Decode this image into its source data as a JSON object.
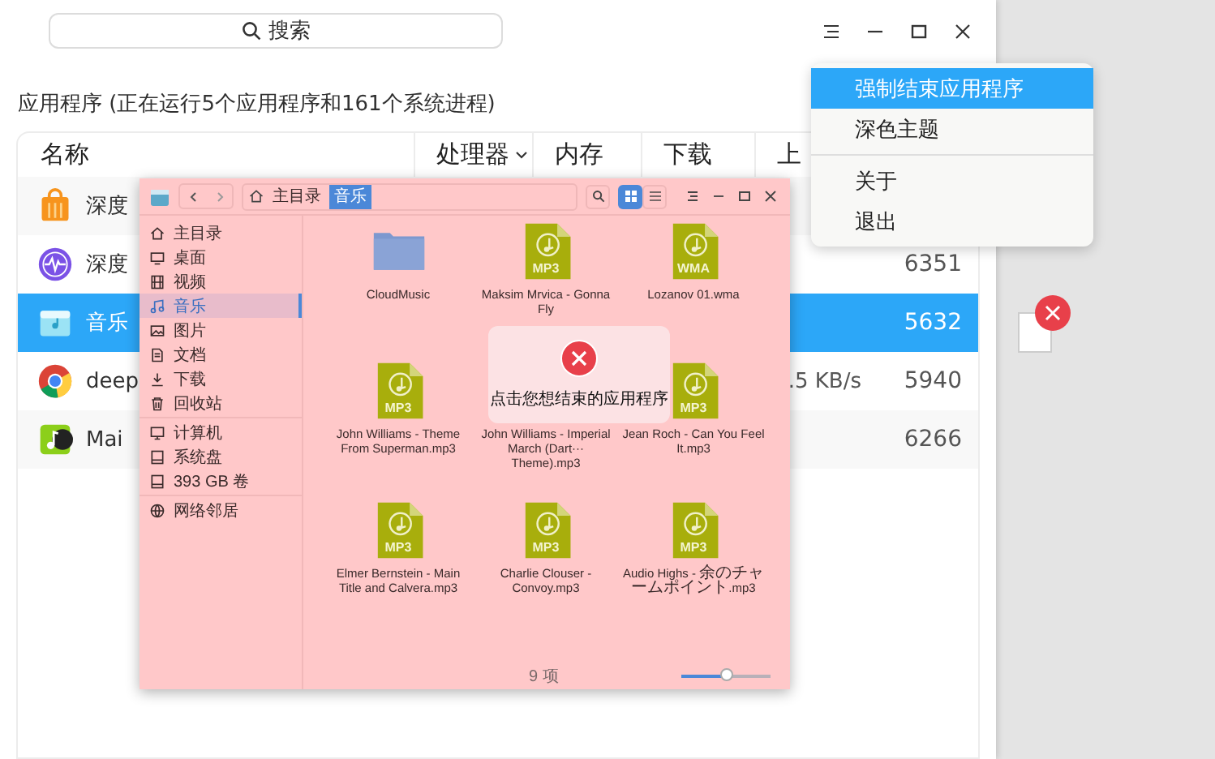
{
  "search": {
    "placeholder": "搜索"
  },
  "caption": "应用程序 (正在运行5个应用程序和161个系统进程)",
  "table": {
    "columns": [
      {
        "label": "名称",
        "sorted": false
      },
      {
        "label": "处理器",
        "sorted": true
      },
      {
        "label": "内存",
        "sorted": false
      },
      {
        "label": "下载",
        "sorted": false
      },
      {
        "label": "上",
        "sorted": false
      }
    ],
    "rows": [
      {
        "name": "深度",
        "selected": false
      },
      {
        "name": "深度",
        "column_6": "6351",
        "selected": false
      },
      {
        "name": "音乐",
        "column_6": "5632",
        "selected": true
      },
      {
        "name": "deep",
        "upload": ".5 KB/s",
        "column_6": "5940",
        "selected": false
      },
      {
        "name": "Mai",
        "column_6": "6266",
        "selected": false
      }
    ]
  },
  "file_manager": {
    "breadcrumb": [
      {
        "label": "主目录",
        "selected": false
      },
      {
        "label": "音乐",
        "selected": true
      }
    ],
    "view_modes": [
      {
        "kind": "grid",
        "selected": true
      },
      {
        "kind": "list",
        "selected": false
      }
    ],
    "sidebar": {
      "groups": [
        [
          {
            "label": "主目录",
            "selected": false
          },
          {
            "label": "桌面",
            "selected": false
          },
          {
            "label": "视频",
            "selected": false
          },
          {
            "label": "音乐",
            "selected": true
          },
          {
            "label": "图片",
            "selected": false
          },
          {
            "label": "文档",
            "selected": false
          },
          {
            "label": "下载",
            "selected": false
          },
          {
            "label": "回收站",
            "selected": false
          }
        ],
        [
          {
            "label": "计算机",
            "selected": false
          },
          {
            "label": "系统盘",
            "selected": false
          },
          {
            "label": "393 GB 卷",
            "selected": false
          }
        ],
        [
          {
            "label": "网络邻居",
            "selected": false
          }
        ]
      ]
    },
    "files": [
      {
        "kind": "folder",
        "name": "CloudMusic"
      },
      {
        "kind": "audio",
        "badge": "MP3",
        "name": "Maksim Mrvica - Gonna Fly"
      },
      {
        "kind": "audio",
        "badge": "WMA",
        "name": "Lozanov 01.wma"
      },
      {
        "kind": "audio",
        "badge": "MP3",
        "name": "John Williams - Theme From Superman.mp3"
      },
      {
        "kind": "covered",
        "name": "John Williams - Imperial March (Dart··· Theme).mp3"
      },
      {
        "kind": "audio",
        "badge": "MP3",
        "name": "Jean Roch - Can You Feel It.mp3"
      },
      {
        "kind": "audio",
        "badge": "MP3",
        "name": "Elmer Bernstein - Main Title and Calvera.mp3"
      },
      {
        "kind": "audio",
        "badge": "MP3",
        "name": "Charlie Clouser - Convoy.mp3"
      },
      {
        "kind": "audio",
        "badge": "MP3",
        "name": "Audio Highs - 余のチャームポイント.mp3"
      }
    ],
    "status": "9 项",
    "zoom_slider": {
      "level": 0.5
    },
    "toast": {
      "message": "点击您想结束的应用程序"
    }
  },
  "menu": {
    "groups": [
      [
        {
          "label": "强制结束应用程序",
          "selected": true
        },
        {
          "label": "深色主题",
          "selected": false
        }
      ],
      [
        {
          "label": "关于",
          "selected": false
        },
        {
          "label": "退出",
          "selected": false
        }
      ]
    ]
  }
}
